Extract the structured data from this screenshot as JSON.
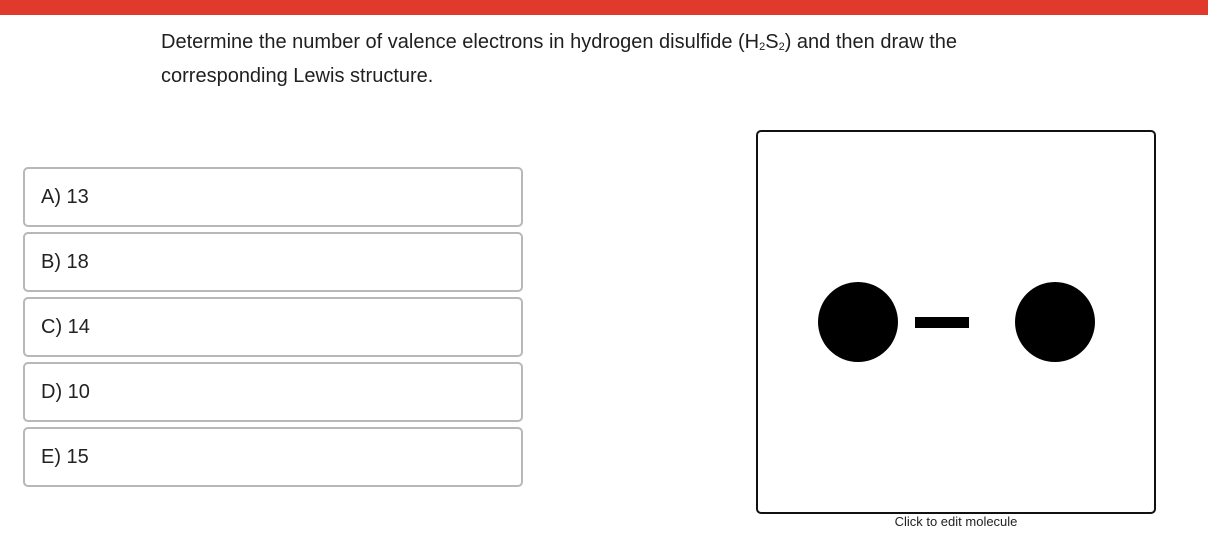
{
  "question": {
    "part1": "Determine the number of valence electrons in hydrogen disulfide (H",
    "sub1": "2",
    "part2": "S",
    "sub2": "2",
    "part3": ") and then draw the corresponding Lewis structure."
  },
  "options": [
    {
      "label": "A) 13"
    },
    {
      "label": "B) 18"
    },
    {
      "label": "C) 14"
    },
    {
      "label": "D) 10"
    },
    {
      "label": "E) 15"
    }
  ],
  "molecule_editor": {
    "edit_label": "Click to edit molecule"
  },
  "colors": {
    "top_bar": "#e03a2c",
    "option_border": "#b8b8b8",
    "atom": "#000000"
  }
}
